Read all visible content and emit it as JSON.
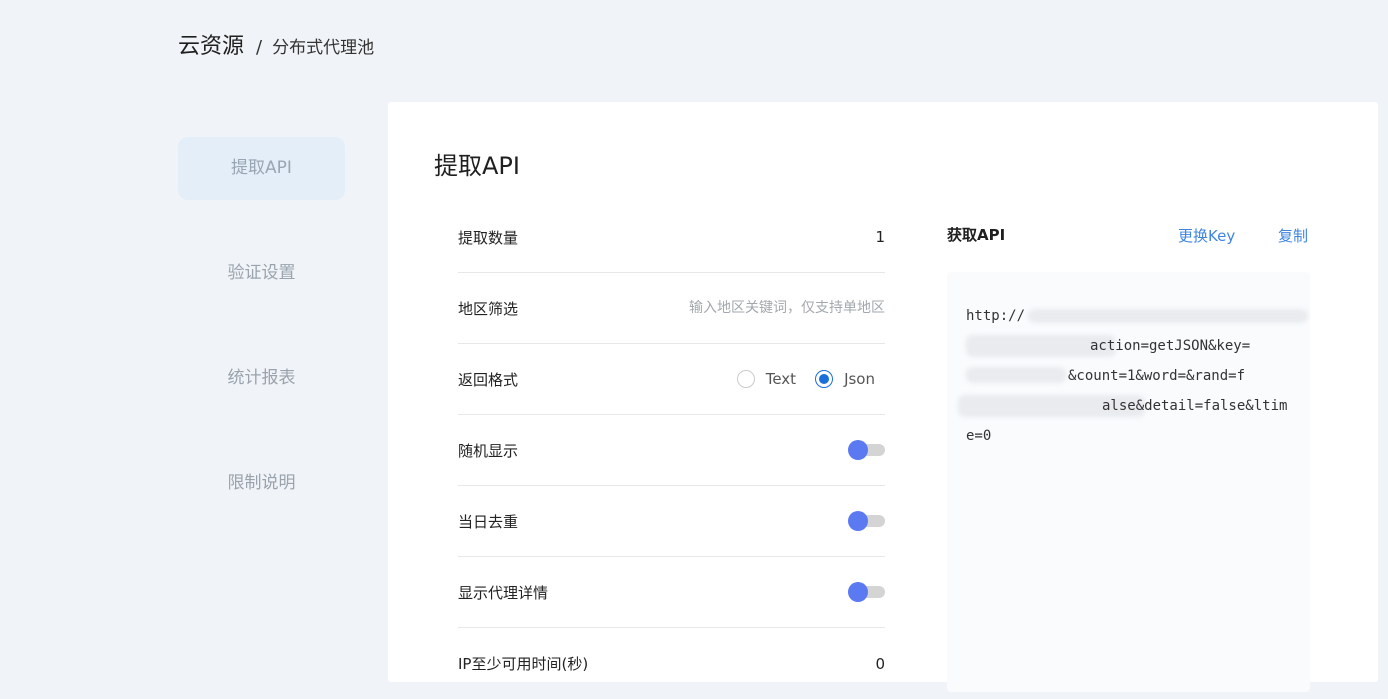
{
  "breadcrumb": {
    "root": "云资源",
    "separator": "/",
    "current": "分布式代理池"
  },
  "sidebar": {
    "items": [
      {
        "label": "提取API",
        "active": true
      },
      {
        "label": "验证设置",
        "active": false
      },
      {
        "label": "统计报表",
        "active": false
      },
      {
        "label": "限制说明",
        "active": false
      }
    ]
  },
  "main": {
    "title": "提取API",
    "form": {
      "extract_count": {
        "label": "提取数量",
        "value": "1"
      },
      "region_filter": {
        "label": "地区筛选",
        "placeholder": "输入地区关键词，仅支持单地区",
        "value": ""
      },
      "return_format": {
        "label": "返回格式",
        "options": [
          "Text",
          "Json"
        ],
        "selected": "Json"
      },
      "random_display": {
        "label": "随机显示",
        "on": false
      },
      "daily_dedup": {
        "label": "当日去重",
        "on": false
      },
      "show_proxy_detail": {
        "label": "显示代理详情",
        "on": false
      },
      "min_available_time": {
        "label": "IP至少可用时间(秒)",
        "value": "0"
      }
    },
    "api_panel": {
      "title": "获取API",
      "change_key_label": "更换Key",
      "copy_label": "复制",
      "url_lines": [
        "http://",
        "action=getJSON&key=",
        "&count=1&word=&rand=f",
        "alse&detail=false&ltim",
        "e=0"
      ]
    }
  },
  "colors": {
    "accent": "#1a6fdb",
    "link": "#3f85e0",
    "toggle_knob": "#5b79f0",
    "page_bg": "#f0f3f7",
    "nav_active_bg": "#e4eef9"
  }
}
